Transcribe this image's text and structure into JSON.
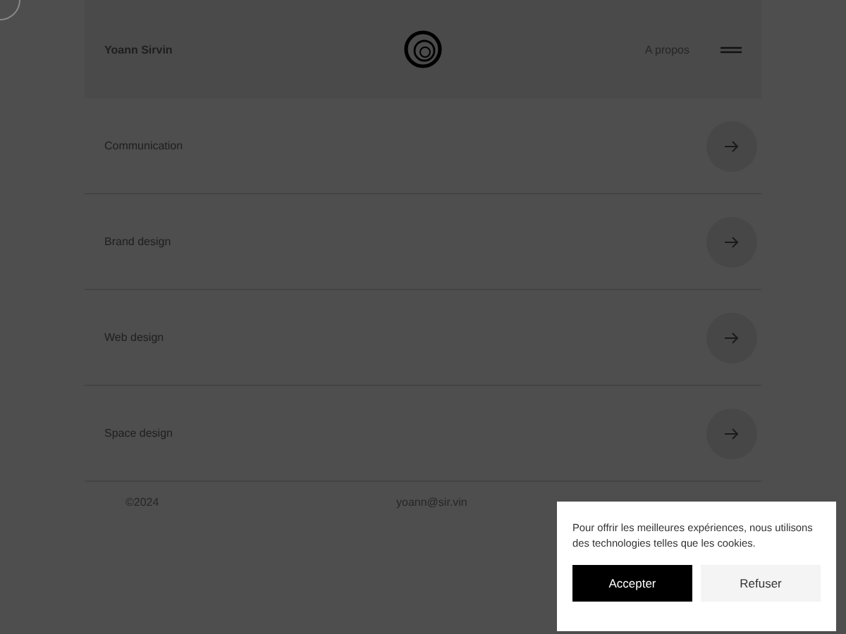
{
  "header": {
    "name": "Yoann Sirvin",
    "nav_link": "A propos"
  },
  "services": [
    {
      "label": "Communication"
    },
    {
      "label": "Brand design"
    },
    {
      "label": "Web design"
    },
    {
      "label": "Space design"
    }
  ],
  "footer": {
    "copyright": "©2024",
    "email": "yoann@sir.vin"
  },
  "cookie_banner": {
    "message": "Pour offrir les meilleures expériences, nous utilisons des technologies telles que les cookies.",
    "buttons": [
      {
        "label": "Accepter",
        "kind": "primary"
      },
      {
        "label": "Refuser",
        "kind": "secondary"
      }
    ]
  }
}
